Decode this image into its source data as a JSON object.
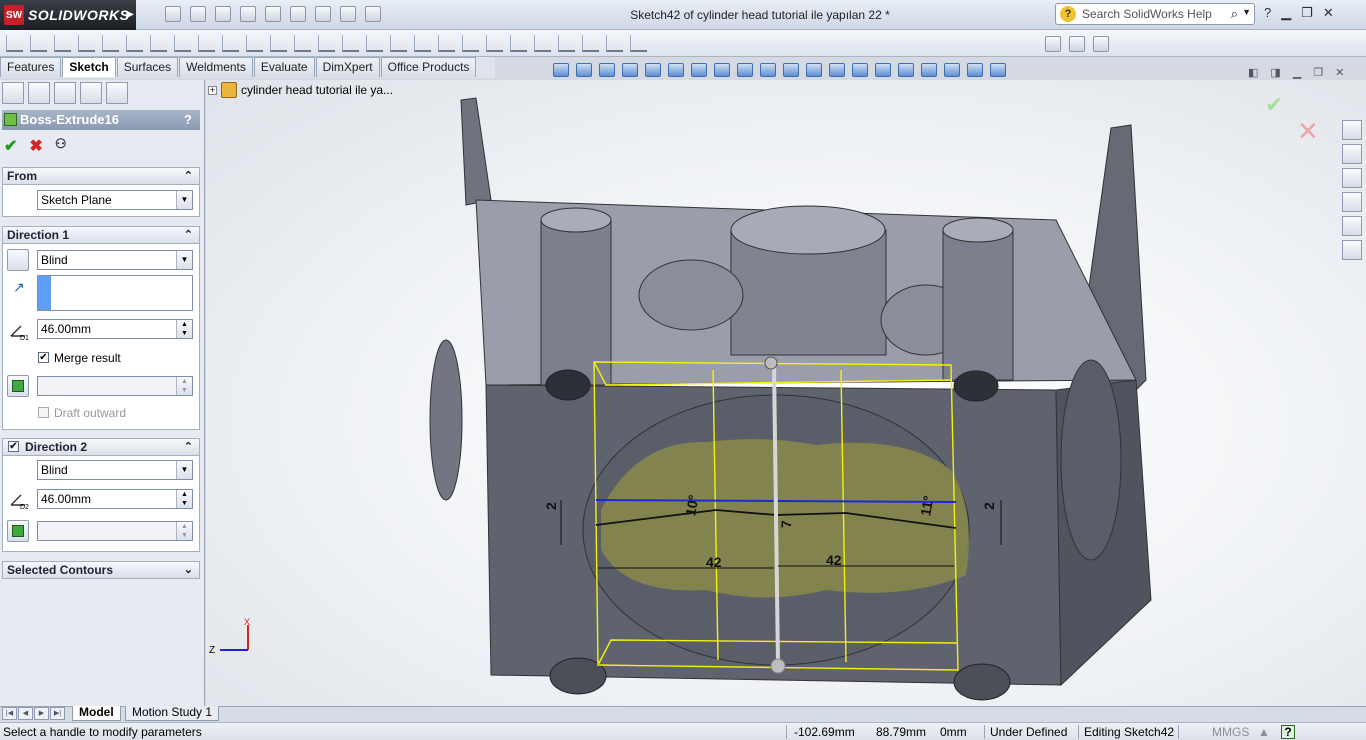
{
  "app": {
    "name": "SOLIDWORKS",
    "logo_letters": "SW"
  },
  "window": {
    "title": "Sketch42 of cylinder head tutorial ile yapılan 22 *"
  },
  "search": {
    "placeholder": "Search SolidWorks Help"
  },
  "tabs": [
    {
      "label": "Features",
      "active": false
    },
    {
      "label": "Sketch",
      "active": true
    },
    {
      "label": "Surfaces",
      "active": false
    },
    {
      "label": "Weldments",
      "active": false
    },
    {
      "label": "Evaluate",
      "active": false
    },
    {
      "label": "DimXpert",
      "active": false
    },
    {
      "label": "Office Products",
      "active": false
    }
  ],
  "property_manager": {
    "title": "Boss-Extrude16",
    "help": "?",
    "from": {
      "header": "From",
      "value": "Sketch Plane"
    },
    "direction1": {
      "header": "Direction 1",
      "end_condition": "Blind",
      "depth": "46.00mm",
      "merge_label": "Merge result",
      "merge_checked": true,
      "draft_label": "Draft outward",
      "draft_checked": false
    },
    "direction2": {
      "header": "Direction 2",
      "checked": true,
      "end_condition": "Blind",
      "depth": "46.00mm"
    },
    "selected_contours": {
      "header": "Selected Contours"
    },
    "depth_icon_labels": {
      "d1": "D1",
      "d2": "D2"
    }
  },
  "tree": {
    "root_label": "cylinder head tutorial ile ya..."
  },
  "sketch_dims": {
    "left_offset": "2",
    "right_offset": "2",
    "angle_left": "10°",
    "angle_right": "11°",
    "center_height": "7",
    "width_left": "42",
    "width_right": "42"
  },
  "triad": {
    "x_axis": "X",
    "z_axis": "Z"
  },
  "bottom_tabs": [
    {
      "label": "Model",
      "active": true
    },
    {
      "label": "Motion Study 1",
      "active": false
    }
  ],
  "status": {
    "message": "Select a handle to modify parameters",
    "x": "-102.69mm",
    "y": "88.79mm",
    "z": "0mm",
    "state": "Under Defined",
    "editing": "Editing Sketch42",
    "units": "MMGS",
    "help": "?"
  },
  "colors": {
    "accent": "#c8202a",
    "part": "#6d717c",
    "sketch_yellow": "#f5f010",
    "sketch_blue": "#1a2ad8",
    "fill_olive": "#8a8a4a"
  }
}
